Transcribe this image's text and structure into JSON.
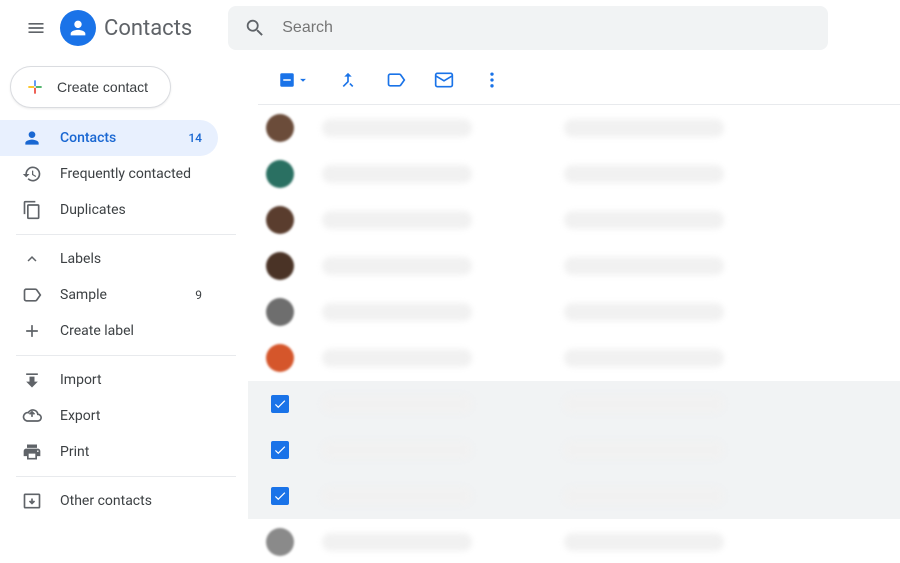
{
  "app_title": "Contacts",
  "search": {
    "placeholder": "Search"
  },
  "create_button": "Create contact",
  "sidebar": {
    "items": [
      {
        "label": "Contacts",
        "count": "14"
      },
      {
        "label": "Frequently contacted"
      },
      {
        "label": "Duplicates"
      }
    ],
    "labels_header": "Labels",
    "labels": [
      {
        "label": "Sample",
        "count": "9"
      }
    ],
    "create_label": "Create label",
    "import": "Import",
    "export": "Export",
    "print": "Print",
    "other": "Other contacts"
  },
  "contacts": [
    {
      "selected": false,
      "avatar_color": "#6b4c3a"
    },
    {
      "selected": false,
      "avatar_color": "#2a7062"
    },
    {
      "selected": false,
      "avatar_color": "#5a3d2e"
    },
    {
      "selected": false,
      "avatar_color": "#4a3326"
    },
    {
      "selected": false,
      "avatar_color": "#6e6e6e"
    },
    {
      "selected": false,
      "avatar_color": "#d5562b"
    },
    {
      "selected": true,
      "avatar_color": "#7a7a7a"
    },
    {
      "selected": true,
      "avatar_color": "#7a7a7a"
    },
    {
      "selected": true,
      "avatar_color": "#7a7a7a"
    },
    {
      "selected": false,
      "avatar_color": "#8a8a8a"
    }
  ],
  "colors": {
    "accent": "#1a73e8",
    "active_bg": "#e8f0fe",
    "active_fg": "#1967d2"
  }
}
